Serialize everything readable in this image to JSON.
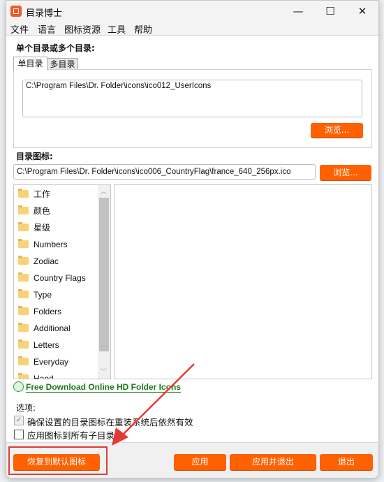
{
  "window": {
    "title": "目录博士",
    "minimize": "—",
    "maximize": "☐",
    "close": "✕"
  },
  "menu": [
    "文件",
    "语言",
    "图标资源",
    "工具",
    "帮助"
  ],
  "dir_section": {
    "label": "单个目录或多个目录:",
    "tabs": [
      {
        "label": "单目录",
        "active": true
      },
      {
        "label": "多目录",
        "active": false
      }
    ],
    "path": "C:\\Program Files\\Dr. Folder\\icons\\ico012_UserIcons",
    "browse": "浏览..."
  },
  "icon_section": {
    "label": "目录图标:",
    "path": "C:\\Program Files\\Dr. Folder\\icons\\ico006_CountryFlag\\france_640_256px.ico",
    "browse": "浏览...",
    "categories": [
      "工作",
      "颜色",
      "星级",
      "Numbers",
      "Zodiac",
      "Country Flags",
      "Type",
      "Folders",
      "Additional",
      "Letters",
      "Everyday",
      "Hand"
    ]
  },
  "link": "Free Download Online HD Folder Icons",
  "options": {
    "label": "选项:",
    "items": [
      {
        "label": "确保设置的目录图标在重装系统后依然有效",
        "checked": true,
        "disabled": true
      },
      {
        "label": "应用图标到所有子目录",
        "checked": false
      }
    ]
  },
  "buttons": {
    "restore": "恢复到默认图标",
    "apply": "应用",
    "apply_exit": "应用并退出",
    "exit": "退出"
  },
  "colors": {
    "accent": "#ff6000",
    "highlight": "#e53935",
    "link": "#1a7a1a"
  }
}
